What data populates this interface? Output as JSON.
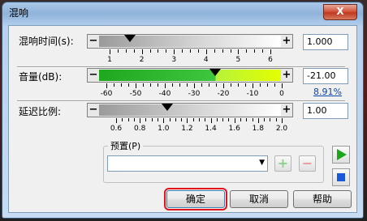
{
  "window": {
    "title": "混响",
    "close_label": "X"
  },
  "reverb_time": {
    "label": "混响时间(s):",
    "value": "1.000",
    "slider_fraction": 0.17,
    "ticks": [
      "1",
      "2",
      "3",
      "4",
      "5",
      "6"
    ]
  },
  "volume": {
    "label": "音量(dB):",
    "value": "-21.00",
    "percent": "8.91%",
    "slider_fraction": 0.64,
    "ticks": [
      "-60",
      "-50",
      "-40",
      "-30",
      "-20",
      "-10",
      "0"
    ],
    "colors": {
      "green": "#1fa81f",
      "yellow": "#e4ff00"
    }
  },
  "delay_ratio": {
    "label": "延迟比例:",
    "value": "1.00",
    "slider_fraction": 0.375,
    "ticks": [
      "0.6",
      "0.8",
      "1.0",
      "1.2",
      "1.4",
      "1.6",
      "1.8",
      "2.0"
    ]
  },
  "preset": {
    "label": "预置(P)",
    "value": "",
    "add_icon": "plus-icon",
    "remove_icon": "minus-icon"
  },
  "buttons": {
    "ok": "确定",
    "cancel": "取消",
    "help": "帮助"
  },
  "slider_symbols": {
    "minus": "−",
    "plus": "+"
  },
  "play_icon": "play-icon",
  "stop_icon": "stop-icon",
  "colors": {
    "highlight": "#e0141a",
    "play": "#1aa81a",
    "stop": "#1a5ad8"
  }
}
